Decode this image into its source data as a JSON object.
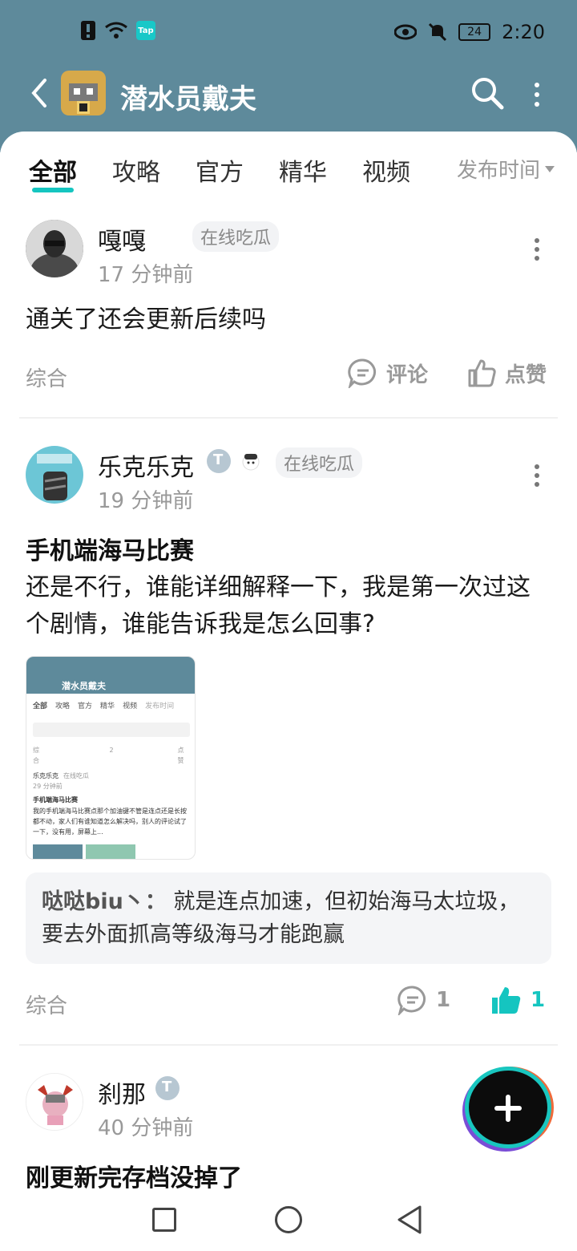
{
  "status_bar": {
    "time": "2:20",
    "battery": "24",
    "tap_badge": "Tap"
  },
  "header": {
    "title": "潜水员戴夫"
  },
  "tabs": [
    {
      "label": "全部",
      "active": true
    },
    {
      "label": "攻略"
    },
    {
      "label": "官方"
    },
    {
      "label": "精华"
    },
    {
      "label": "视频"
    }
  ],
  "sort": {
    "label": "发布时间"
  },
  "posts": [
    {
      "author": "嘎嘎",
      "tag": "在线吃瓜",
      "time": "17 分钟前",
      "body": "通关了还会更新后续吗",
      "category": "综合",
      "comment_label": "评论",
      "like_label": "点赞"
    },
    {
      "author": "乐克乐克",
      "tag": "在线吃瓜",
      "time": "19 分钟前",
      "title": "手机端海马比赛",
      "body": "还是不行，谁能详细解释一下，我是第一次过这个剧情，谁能告诉我是怎么回事?",
      "thumbnail": {
        "title": "潜水员戴夫",
        "tabs": [
          "全部",
          "攻略",
          "官方",
          "精华",
          "视频",
          "发布时间"
        ],
        "category": "综合",
        "comment_count": "2",
        "like_label": "点赞",
        "author": "乐克乐克",
        "tag": "在线吃瓜",
        "time": "29 分钟前",
        "post_title": "手机端海马比赛",
        "post_text": "我的手机端海马比赛点那个加油键不管是连点还是长按都不动，家人们有谁知道怎么解决吗，别人的评论试了一下，没有用，屏幕上..."
      },
      "top_comment": {
        "user": "哒哒biu丶：",
        "text": "就是连点加速，但初始海马太垃圾，要去外面抓高等级海马才能跑赢"
      },
      "category": "综合",
      "comment_count": "1",
      "like_count": "1"
    },
    {
      "author": "刹那",
      "time": "40 分钟前",
      "title": "刚更新完存档没掉了"
    }
  ],
  "colors": {
    "header_bg": "#5e8a9b",
    "accent": "#15c5c0",
    "muted": "#999999"
  }
}
